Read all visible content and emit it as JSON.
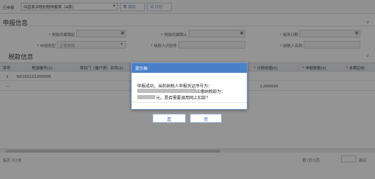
{
  "toolbar": {
    "period_label": "已申报",
    "report_select": "问道系涉税的税种报表（A表）",
    "save_label": "保存",
    "print_label": "打印"
  },
  "declare_section": {
    "title": "申报信息",
    "fields": [
      {
        "label": "税款所属期起",
        "required": true
      },
      {
        "label": "税款所属期止",
        "required": true
      },
      {
        "label": "填表日期",
        "required": true
      },
      {
        "label": "申报类型",
        "value": "正常申报",
        "required": true
      },
      {
        "label": "纳税人识别号",
        "required": true
      },
      {
        "label": "纳税人名称",
        "required": true
      }
    ]
  },
  "tax_section": {
    "title": "税款信息",
    "columns": [
      "序号",
      "税源编号(1)",
      "项目门（楼户房）名称(2)",
      "计税依据(5)",
      "申报税额(6)",
      "本期应纳"
    ],
    "rows": [
      {
        "index": "1",
        "code": "N2102121200005",
        "basis": "",
        "tax": ""
      },
      {
        "index": "--",
        "code": "",
        "basis": "1,000000",
        "tax": ""
      }
    ]
  },
  "dialog": {
    "title": "提示框",
    "line1": "申报成功，当前纳税人申报凭证序号为：",
    "line2_suffix": "应缴纳税款为：",
    "line3_suffix": "元。是否需要调用网上扣款？",
    "yes_label": "是",
    "no_label": "否"
  },
  "footer": {
    "record_info": "每页",
    "record_count": "共1条",
    "page_info": "第1页/1页",
    "goto_label": "确定"
  }
}
